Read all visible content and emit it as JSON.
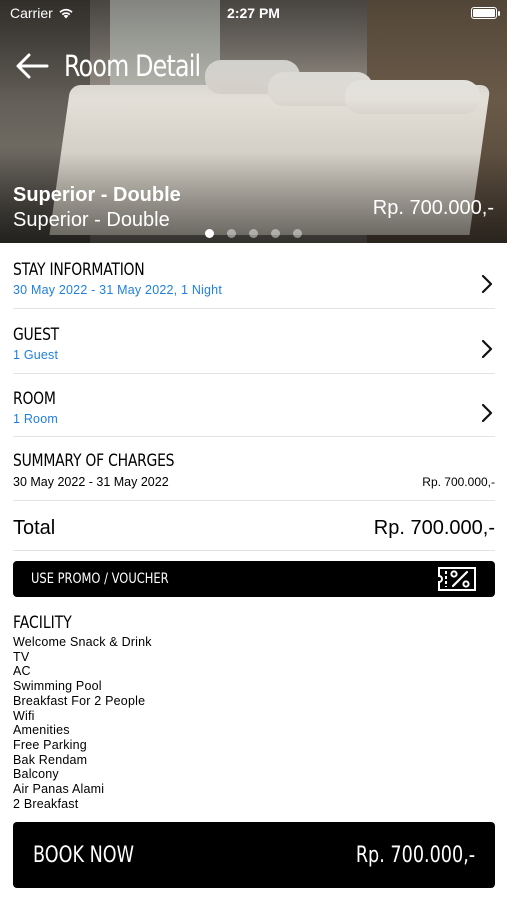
{
  "status_bar": {
    "carrier": "Carrier",
    "time": "2:27 PM"
  },
  "nav": {
    "title": "Room Detail"
  },
  "hero": {
    "room_name": "Superior - Double",
    "room_subtitle": "Superior - Double",
    "price": "Rp. 700.000,-",
    "page_count": 5,
    "active_page": 1
  },
  "stay": {
    "label": "STAY INFORMATION",
    "value": "30 May 2022 - 31 May 2022, 1 Night"
  },
  "guest": {
    "label": "GUEST",
    "value": "1 Guest"
  },
  "room": {
    "label": "ROOM",
    "value": "1 Room"
  },
  "summary": {
    "label": "SUMMARY OF CHARGES",
    "dates": "30 May 2022 - 31 May 2022",
    "amount": "Rp. 700.000,-"
  },
  "total": {
    "label": "Total",
    "amount": "Rp. 700.000,-"
  },
  "promo": {
    "label": "USE PROMO / VOUCHER"
  },
  "facility": {
    "label": "FACILITY",
    "items": [
      "Welcome Snack & Drink",
      "TV",
      "AC",
      "Swimming Pool",
      "Breakfast For 2 People",
      "Wifi",
      "Amenities",
      "Free Parking",
      "Bak Rendam",
      "Balcony",
      "Air Panas Alami",
      "2 Breakfast"
    ]
  },
  "book": {
    "label": "BOOK NOW",
    "price": "Rp. 700.000,-"
  },
  "colors": {
    "accent_blue": "#1f7fe0",
    "button_black": "#000000"
  }
}
